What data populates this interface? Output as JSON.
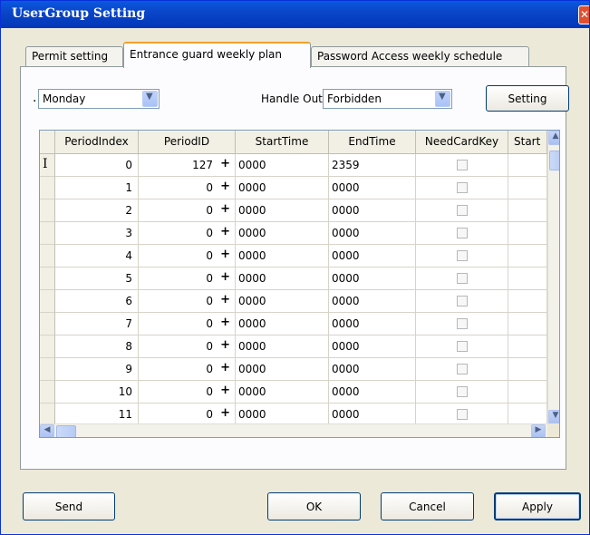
{
  "window": {
    "title": "UserGroup Setting",
    "close_glyph": "✕"
  },
  "tabs": [
    {
      "label": "Permit setting",
      "active": false
    },
    {
      "label": "Entrance guard weekly plan",
      "active": true
    },
    {
      "label": "Password Access weekly schedule",
      "active": false
    }
  ],
  "controls": {
    "leading_mark": ".",
    "day_select": {
      "value": "Monday"
    },
    "handle_out_label": "Handle Out",
    "handle_out_select": {
      "value": "Forbidden"
    },
    "setting_button": "Setting"
  },
  "grid": {
    "columns": [
      "PeriodIndex",
      "PeriodID",
      "StartTime",
      "EndTime",
      "NeedCardKey",
      "Start"
    ],
    "rows": [
      {
        "index": "0",
        "period_id": "127",
        "start": "0000",
        "end": "2359"
      },
      {
        "index": "1",
        "period_id": "0",
        "start": "0000",
        "end": "0000"
      },
      {
        "index": "2",
        "period_id": "0",
        "start": "0000",
        "end": "0000"
      },
      {
        "index": "3",
        "period_id": "0",
        "start": "0000",
        "end": "0000"
      },
      {
        "index": "4",
        "period_id": "0",
        "start": "0000",
        "end": "0000"
      },
      {
        "index": "5",
        "period_id": "0",
        "start": "0000",
        "end": "0000"
      },
      {
        "index": "6",
        "period_id": "0",
        "start": "0000",
        "end": "0000"
      },
      {
        "index": "7",
        "period_id": "0",
        "start": "0000",
        "end": "0000"
      },
      {
        "index": "8",
        "period_id": "0",
        "start": "0000",
        "end": "0000"
      },
      {
        "index": "9",
        "period_id": "0",
        "start": "0000",
        "end": "0000"
      },
      {
        "index": "10",
        "period_id": "0",
        "start": "0000",
        "end": "0000"
      },
      {
        "index": "11",
        "period_id": "0",
        "start": "0000",
        "end": "0000"
      }
    ],
    "cursor_glyph": "I",
    "plus_glyph": "+",
    "scroll": {
      "up": "▲",
      "down": "▼",
      "left": "◀",
      "right": "▶"
    }
  },
  "buttons": {
    "send": "Send",
    "ok": "OK",
    "cancel": "Cancel",
    "apply": "Apply"
  },
  "icons": {
    "close": "close-icon",
    "dropdown": "chevron-down-icon",
    "add": "plus-icon",
    "row_cursor": "text-cursor-icon",
    "checkbox": "checkbox-icon"
  }
}
